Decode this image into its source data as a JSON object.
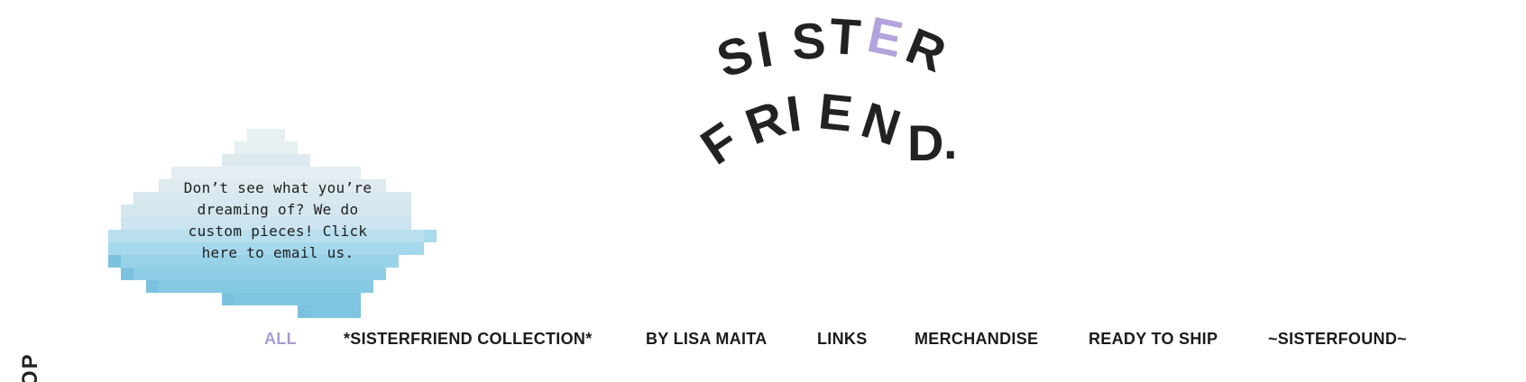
{
  "logo": {
    "line1": "SISTER",
    "line2": "FRIEND.",
    "letters_line1": [
      "S",
      "I",
      "S",
      "T",
      "E",
      "R"
    ],
    "letters_line2": [
      "F",
      "R",
      "I",
      "E",
      "N",
      "D",
      "."
    ],
    "text_color": "#222222",
    "accent_color": "#b3a3dc"
  },
  "cloud": {
    "message": "Don’t see what you’re dreaming of? We do custom pieces! Click here to email us.",
    "lines": [
      "Don’t see what you’re",
      "dreaming of? We do",
      "custom pieces! Click",
      "here to email us."
    ]
  },
  "side": {
    "label": "OP"
  },
  "nav": {
    "items": [
      {
        "label": "ALL",
        "active": true
      },
      {
        "label": "*SISTERFRIEND COLLECTION*",
        "active": false
      },
      {
        "label": "BY LISA MAITA",
        "active": false
      },
      {
        "label": "LINKS",
        "active": false
      },
      {
        "label": "MERCHANDISE",
        "active": false
      },
      {
        "label": "READY TO SHIP",
        "active": false
      },
      {
        "label": "~SISTERFOUND~",
        "active": false
      }
    ],
    "active_color": "#a99bd6"
  }
}
